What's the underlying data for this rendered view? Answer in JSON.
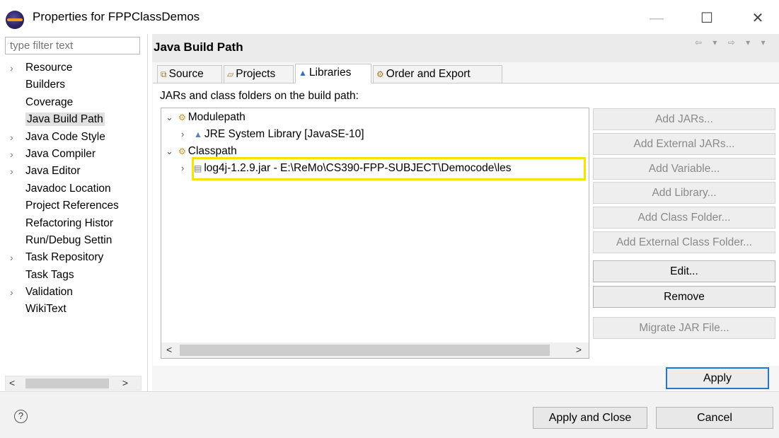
{
  "window": {
    "title": "Properties for FPPClassDemos",
    "minimize": "—",
    "maximize": "☐",
    "close": "✕"
  },
  "filter": {
    "placeholder": "type filter text"
  },
  "nav_tree": [
    {
      "label": "Resource",
      "expandable": true
    },
    {
      "label": "Builders",
      "expandable": false
    },
    {
      "label": "Coverage",
      "expandable": false
    },
    {
      "label": "Java Build Path",
      "expandable": false,
      "selected": true
    },
    {
      "label": "Java Code Style",
      "expandable": true
    },
    {
      "label": "Java Compiler",
      "expandable": true
    },
    {
      "label": "Java Editor",
      "expandable": true
    },
    {
      "label": "Javadoc Location",
      "expandable": false
    },
    {
      "label": "Project References",
      "expandable": false
    },
    {
      "label": "Refactoring Histor",
      "expandable": false
    },
    {
      "label": "Run/Debug Settin",
      "expandable": false
    },
    {
      "label": "Task Repository",
      "expandable": true
    },
    {
      "label": "Task Tags",
      "expandable": false
    },
    {
      "label": "Validation",
      "expandable": true
    },
    {
      "label": "WikiText",
      "expandable": false
    }
  ],
  "page": {
    "title": "Java Build Path",
    "nav_arrows": "⇦ ▾ ⇨ ▾ ▾"
  },
  "tabs": [
    {
      "label": "Source",
      "icon": "source-folder-icon",
      "glyph": "⧉"
    },
    {
      "label": "Projects",
      "icon": "project-icon",
      "glyph": "▱"
    },
    {
      "label": "Libraries",
      "icon": "libraries-icon",
      "glyph": "▲",
      "active": true
    },
    {
      "label": "Order and Export",
      "icon": "order-export-icon",
      "glyph": "⚙"
    }
  ],
  "libraries": {
    "section_label": "JARs and class folders on the build path:",
    "modulepath": "Modulepath",
    "jre": "JRE System Library [JavaSE-10]",
    "classpath": "Classpath",
    "jar": "log4j-1.2.9.jar - E:\\ReMo\\CS390-FPP-SUBJECT\\Democode\\les"
  },
  "side_buttons": {
    "add_jars": "Add JARs...",
    "add_external_jars": "Add External JARs...",
    "add_variable": "Add Variable...",
    "add_library": "Add Library...",
    "add_class_folder": "Add Class Folder...",
    "add_external_class_folder": "Add External Class Folder...",
    "edit": "Edit...",
    "remove": "Remove",
    "migrate_jar": "Migrate JAR File..."
  },
  "buttons": {
    "apply": "Apply",
    "apply_and_close": "Apply and Close",
    "cancel": "Cancel"
  },
  "colors": {
    "highlight": "#f5e400",
    "default_button_border": "#1e78d4"
  }
}
